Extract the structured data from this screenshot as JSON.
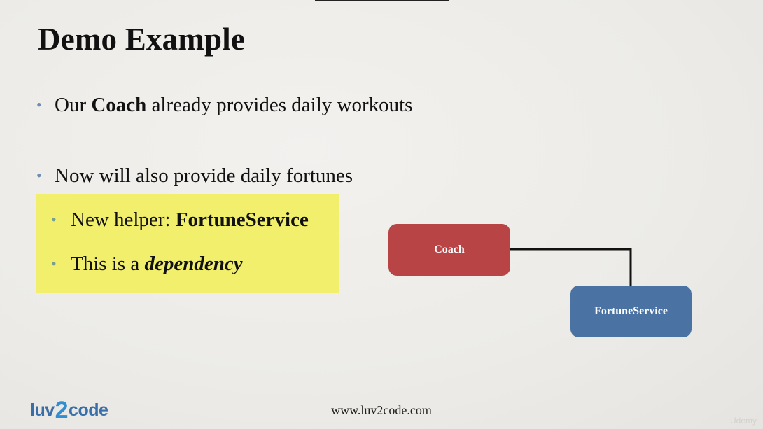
{
  "slide": {
    "title": "Demo Example",
    "bullets": [
      {
        "pre": "Our ",
        "bold": "Coach",
        "post": " already provides daily workouts"
      },
      {
        "text": "Now will also provide daily fortunes"
      }
    ],
    "sub_bullets": [
      {
        "pre": "New helper: ",
        "bold": "FortuneService"
      },
      {
        "pre": "This is a ",
        "emph": "dependency"
      }
    ],
    "highlight_color": "#f1ef6c"
  },
  "diagram": {
    "coach_label": "Coach",
    "fortune_label": "FortuneService",
    "coach_color": "#b94446",
    "fortune_color": "#4a73a3"
  },
  "footer": {
    "logo_left": "luv",
    "logo_mid": "2",
    "logo_right": "code",
    "url": "www.luv2code.com",
    "watermark": "Udemy"
  }
}
